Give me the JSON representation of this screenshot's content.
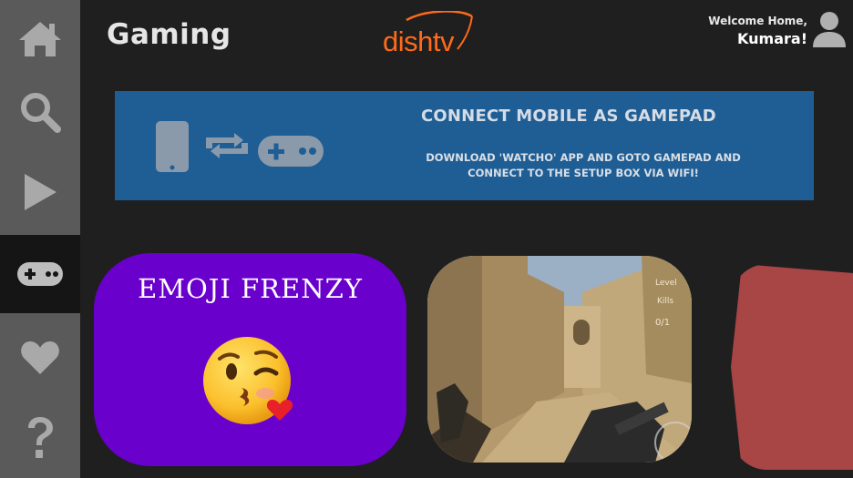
{
  "header": {
    "title": "Gaming",
    "logo_text": "dishtv",
    "welcome_line": "Welcome Home,",
    "user_name": "Kumara!"
  },
  "sidebar": {
    "items": [
      {
        "icon": "home-icon"
      },
      {
        "icon": "search-icon"
      },
      {
        "icon": "play-icon"
      },
      {
        "icon": "gamepad-icon",
        "active": true
      },
      {
        "icon": "heart-icon"
      },
      {
        "icon": "question-icon"
      }
    ]
  },
  "banner": {
    "title": "CONNECT MOBILE AS GAMEPAD",
    "description": "DOWNLOAD 'WATCHO' APP AND GOTO GAMEPAD AND CONNECT TO THE SETUP BOX VIA WIFI!",
    "icons": [
      "phone-icon",
      "sync-icon",
      "gamepad-icon"
    ]
  },
  "games": [
    {
      "title": "EMOJI FRENZY",
      "image": "kissing-face-emoji",
      "color": "#6a00cc"
    },
    {
      "title": "",
      "image": "shooter-game-screenshot",
      "hud": [
        "Level",
        "Kills",
        "0/1"
      ]
    },
    {
      "title": "",
      "color": "#a84545"
    }
  ],
  "colors": {
    "sidebar": "#5a5a5a",
    "active_nav": "#151515",
    "background": "#1f1f1f",
    "banner": "#1f5e95",
    "brand": "#ff6a1a"
  }
}
